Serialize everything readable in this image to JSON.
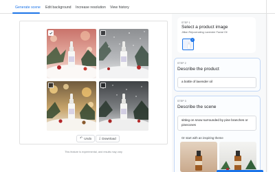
{
  "tabs": [
    {
      "label": "Generate scene",
      "active": true
    },
    {
      "label": "Edit background",
      "active": false
    },
    {
      "label": "Increase resolution",
      "active": false
    },
    {
      "label": "View history",
      "active": false
    }
  ],
  "gallery": {
    "images": [
      {
        "name": "generated-image-1",
        "selected": true,
        "tone": "warm pink bokeh"
      },
      {
        "name": "generated-image-2",
        "selected": false,
        "tone": "grey snowfall"
      },
      {
        "name": "generated-image-3",
        "selected": false,
        "tone": "golden lights"
      },
      {
        "name": "generated-image-4",
        "selected": false,
        "tone": "dark grey snow"
      }
    ],
    "undo_label": "Undo",
    "download_label": "Download",
    "disclaimer": "This feature is experimental, and results may vary"
  },
  "step1": {
    "label": "STEP 1",
    "title": "Select a product image",
    "product_name": "Jillian Rejuvenating Lavender Facial Oil"
  },
  "step2": {
    "label": "STEP 2",
    "title": "Describe the product",
    "value": "a bottle of lavender oil"
  },
  "step3": {
    "label": "STEP 3",
    "title": "Describe the scene",
    "value": "sitting on snow surrounded by pine branches or pinecones",
    "inspire_label": "Or start with an inspiring theme"
  },
  "colors": {
    "accent": "#1a73e8",
    "text": "#202124",
    "muted": "#5f6368",
    "border": "#dadce0"
  },
  "icons": {
    "undo": "undo-icon",
    "download": "download-icon",
    "check": "check-icon"
  }
}
